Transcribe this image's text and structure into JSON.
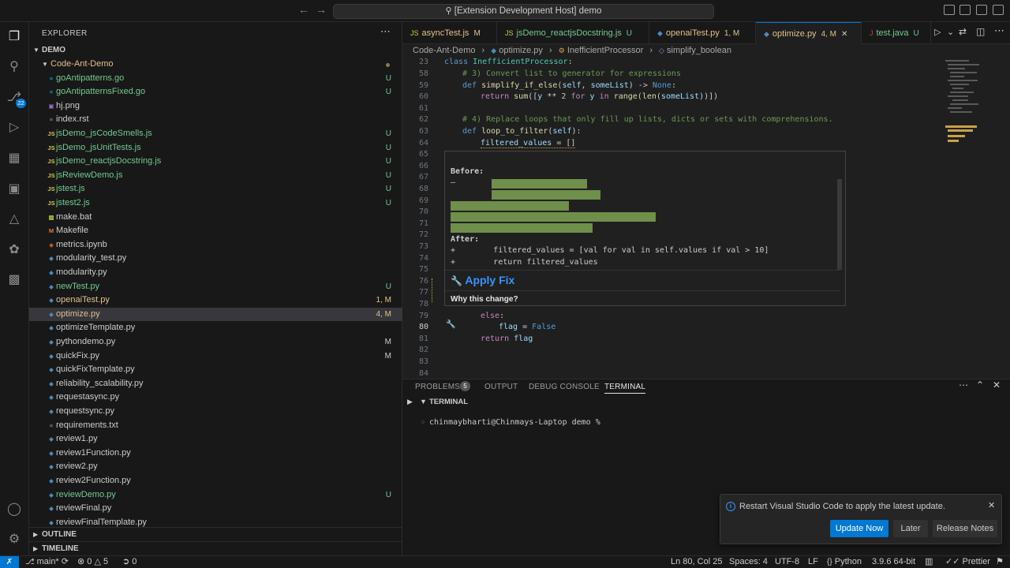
{
  "titlebar": {
    "command_center": "[Extension Development Host] demo"
  },
  "activity_bar": {
    "source_control_badge": "22"
  },
  "explorer": {
    "header": "EXPLORER",
    "workspace": "DEMO",
    "folder": "Code-Ant-Demo",
    "files": [
      {
        "name": "goAntipatterns.go",
        "icon": "go",
        "status": "U",
        "color": "#73c991"
      },
      {
        "name": "goAntipatternsFixed.go",
        "icon": "go",
        "status": "U",
        "color": "#73c991"
      },
      {
        "name": "hj.png",
        "icon": "img",
        "status": "",
        "color": "#cccccc"
      },
      {
        "name": "index.rst",
        "icon": "txt",
        "status": "",
        "color": "#cccccc"
      },
      {
        "name": "jsDemo_jsCodeSmells.js",
        "icon": "JS",
        "status": "U",
        "color": "#73c991"
      },
      {
        "name": "jsDemo_jsUnitTests.js",
        "icon": "JS",
        "status": "U",
        "color": "#73c991"
      },
      {
        "name": "jsDemo_reactjsDocstring.js",
        "icon": "JS",
        "status": "U",
        "color": "#73c991"
      },
      {
        "name": "jsReviewDemo.js",
        "icon": "JS",
        "status": "U",
        "color": "#73c991"
      },
      {
        "name": "jstest.js",
        "icon": "JS",
        "status": "U",
        "color": "#73c991"
      },
      {
        "name": "jstest2.js",
        "icon": "JS",
        "status": "U",
        "color": "#73c991"
      },
      {
        "name": "make.bat",
        "icon": "bat",
        "status": "",
        "color": "#cccccc"
      },
      {
        "name": "Makefile",
        "icon": "M",
        "status": "",
        "color": "#cccccc"
      },
      {
        "name": "metrics.ipynb",
        "icon": "nb",
        "status": "",
        "color": "#cccccc"
      },
      {
        "name": "modularity_test.py",
        "icon": "py",
        "status": "",
        "color": "#cccccc"
      },
      {
        "name": "modularity.py",
        "icon": "py",
        "status": "",
        "color": "#cccccc"
      },
      {
        "name": "newTest.py",
        "icon": "py",
        "status": "U",
        "color": "#73c991"
      },
      {
        "name": "openaiTest.py",
        "icon": "py",
        "status": "1, M",
        "color": "#e2c08d"
      },
      {
        "name": "optimize.py",
        "icon": "py",
        "status": "4, M",
        "color": "#e2c08d",
        "selected": true
      },
      {
        "name": "optimizeTemplate.py",
        "icon": "py",
        "status": "",
        "color": "#cccccc"
      },
      {
        "name": "pythondemo.py",
        "icon": "py",
        "status": "M",
        "color": "#cccccc"
      },
      {
        "name": "quickFix.py",
        "icon": "py",
        "status": "M",
        "color": "#cccccc"
      },
      {
        "name": "quickFixTemplate.py",
        "icon": "py",
        "status": "",
        "color": "#cccccc"
      },
      {
        "name": "reliability_scalability.py",
        "icon": "py",
        "status": "",
        "color": "#cccccc"
      },
      {
        "name": "requestasync.py",
        "icon": "py",
        "status": "",
        "color": "#cccccc"
      },
      {
        "name": "requestsync.py",
        "icon": "py",
        "status": "",
        "color": "#cccccc"
      },
      {
        "name": "requirements.txt",
        "icon": "txt",
        "status": "",
        "color": "#cccccc"
      },
      {
        "name": "review1.py",
        "icon": "py",
        "status": "",
        "color": "#cccccc"
      },
      {
        "name": "review1Function.py",
        "icon": "py",
        "status": "",
        "color": "#cccccc"
      },
      {
        "name": "review2.py",
        "icon": "py",
        "status": "",
        "color": "#cccccc"
      },
      {
        "name": "review2Function.py",
        "icon": "py",
        "status": "",
        "color": "#cccccc"
      },
      {
        "name": "reviewDemo.py",
        "icon": "py",
        "status": "U",
        "color": "#73c991"
      },
      {
        "name": "reviewFinal.py",
        "icon": "py",
        "status": "",
        "color": "#cccccc"
      },
      {
        "name": "reviewFinalTemplate.py",
        "icon": "py",
        "status": "",
        "color": "#cccccc"
      }
    ],
    "outline": "OUTLINE",
    "timeline": "TIMELINE"
  },
  "tabs": [
    {
      "name": "asyncTest.js",
      "icon": "JS",
      "status": "M",
      "color": "#e2c08d"
    },
    {
      "name": "jsDemo_reactjsDocstring.js",
      "icon": "JS",
      "status": "U",
      "color": "#73c991"
    },
    {
      "name": "openaiTest.py",
      "icon": "py",
      "status": "1, M",
      "color": "#e2c08d"
    },
    {
      "name": "optimize.py",
      "icon": "py",
      "status": "4, M",
      "color": "#e2c08d",
      "active": true
    },
    {
      "name": "test.java",
      "icon": "J",
      "status": "U",
      "color": "#73c991"
    }
  ],
  "breadcrumb": [
    "Code-Ant-Demo",
    "optimize.py",
    "InefficientProcessor",
    "simplify_boolean"
  ],
  "editor": {
    "sticky_line": "23",
    "sticky_text": "class InefficientProcessor:",
    "line_numbers": [
      "58",
      "59",
      "60",
      "61",
      "62",
      "63",
      "64",
      "65",
      "66",
      "67",
      "68",
      "69",
      "70",
      "71",
      "72",
      "73",
      "74",
      "75",
      "76",
      "77",
      "78",
      "79",
      "80",
      "81",
      "82",
      "83",
      "84"
    ]
  },
  "hover": {
    "before_label": "Before:",
    "minus": "–",
    "after_label": "After:",
    "after_lines": [
      "+        filtered_values = [val for val in self.values if val > 10]",
      "+        return filtered_values"
    ],
    "apply_fix": "Apply Fix",
    "why": "Why this change?"
  },
  "panel": {
    "tabs": [
      "PROBLEMS",
      "OUTPUT",
      "DEBUG CONSOLE",
      "TERMINAL"
    ],
    "problems_count": "5",
    "terminal_title": "TERMINAL",
    "prompt": "chinmaybharti@Chinmays-Laptop demo %"
  },
  "notification": {
    "message": "Restart Visual Studio Code to apply the latest update.",
    "update_now": "Update Now",
    "later": "Later",
    "release_notes": "Release Notes"
  },
  "statusbar": {
    "branch": "main*",
    "errors": "0",
    "warnings": "5",
    "ports": "0",
    "position": "Ln 80, Col 25",
    "spaces": "Spaces: 4",
    "encoding": "UTF-8",
    "eol": "LF",
    "language": "Python",
    "interpreter": "3.9.6 64-bit",
    "prettier": "Prettier"
  }
}
